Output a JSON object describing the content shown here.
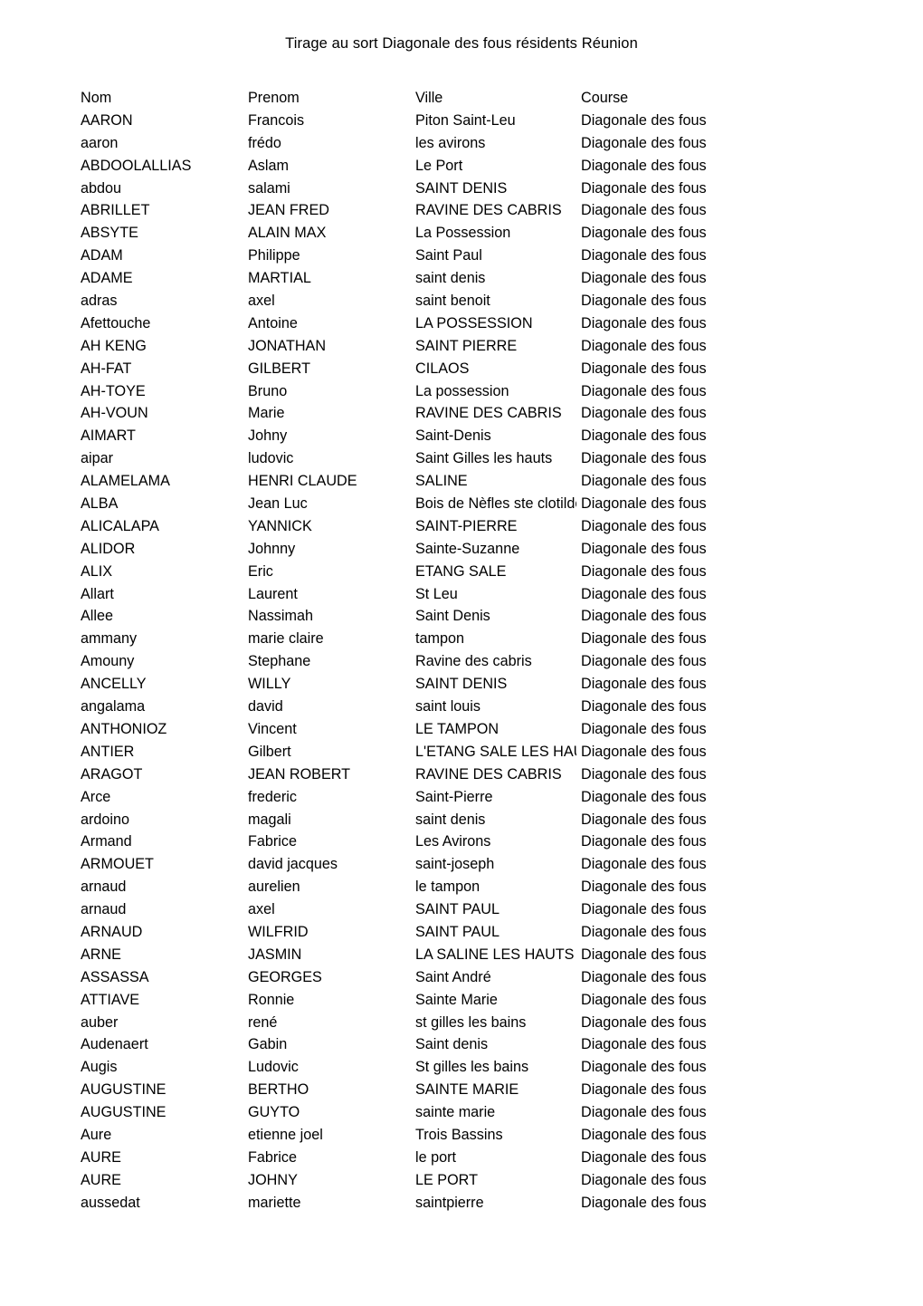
{
  "document": {
    "title": "Tirage au sort Diagonale des fous résidents Réunion"
  },
  "table": {
    "columns": [
      {
        "key": "nom",
        "label": "Nom"
      },
      {
        "key": "prenom",
        "label": "Prenom"
      },
      {
        "key": "ville",
        "label": "Ville"
      },
      {
        "key": "course",
        "label": "Course"
      }
    ],
    "rows": [
      {
        "nom": "AARON",
        "prenom": "Francois",
        "ville": "Piton Saint-Leu",
        "course": "Diagonale des fous"
      },
      {
        "nom": "aaron",
        "prenom": "frédo",
        "ville": "les avirons",
        "course": "Diagonale des fous"
      },
      {
        "nom": "ABDOOLALLIAS",
        "prenom": "Aslam",
        "ville": "Le Port",
        "course": "Diagonale des fous"
      },
      {
        "nom": "abdou",
        "prenom": "salami",
        "ville": "SAINT DENIS",
        "course": "Diagonale des fous"
      },
      {
        "nom": "ABRILLET",
        "prenom": "JEAN FRED",
        "ville": "RAVINE DES CABRIS",
        "course": "Diagonale des fous"
      },
      {
        "nom": "ABSYTE",
        "prenom": "ALAIN MAX",
        "ville": "La Possession",
        "course": "Diagonale des fous"
      },
      {
        "nom": "ADAM",
        "prenom": "Philippe",
        "ville": "Saint Paul",
        "course": "Diagonale des fous"
      },
      {
        "nom": "ADAME",
        "prenom": "MARTIAL",
        "ville": "saint denis",
        "course": "Diagonale des fous"
      },
      {
        "nom": "adras",
        "prenom": "axel",
        "ville": "saint benoit",
        "course": "Diagonale des fous"
      },
      {
        "nom": "Afettouche",
        "prenom": "Antoine",
        "ville": "LA POSSESSION",
        "course": "Diagonale des fous"
      },
      {
        "nom": "AH KENG",
        "prenom": "JONATHAN",
        "ville": "SAINT PIERRE",
        "course": "Diagonale des fous"
      },
      {
        "nom": "AH-FAT",
        "prenom": "GILBERT",
        "ville": "CILAOS",
        "course": "Diagonale des fous"
      },
      {
        "nom": "AH-TOYE",
        "prenom": "Bruno",
        "ville": "La possession",
        "course": "Diagonale des fous"
      },
      {
        "nom": "AH-VOUN",
        "prenom": "Marie",
        "ville": "RAVINE DES CABRIS",
        "course": "Diagonale des fous"
      },
      {
        "nom": "AIMART",
        "prenom": "Johny",
        "ville": "Saint-Denis",
        "course": "Diagonale des fous"
      },
      {
        "nom": "aipar",
        "prenom": "ludovic",
        "ville": "Saint Gilles les hauts",
        "course": "Diagonale des fous"
      },
      {
        "nom": "ALAMELAMA",
        "prenom": "HENRI CLAUDE",
        "ville": "SALINE",
        "course": "Diagonale des fous"
      },
      {
        "nom": "ALBA",
        "prenom": "Jean Luc",
        "ville": "Bois de Nèfles ste clotilde",
        "course": "Diagonale des fous"
      },
      {
        "nom": "ALICALAPA",
        "prenom": "YANNICK",
        "ville": "SAINT-PIERRE",
        "course": "Diagonale des fous"
      },
      {
        "nom": "ALIDOR",
        "prenom": "Johnny",
        "ville": "Sainte-Suzanne",
        "course": "Diagonale des fous"
      },
      {
        "nom": "ALIX",
        "prenom": "Eric",
        "ville": "ETANG SALE",
        "course": "Diagonale des fous"
      },
      {
        "nom": "Allart",
        "prenom": "Laurent",
        "ville": "St Leu",
        "course": "Diagonale des fous"
      },
      {
        "nom": "Allee",
        "prenom": "Nassimah",
        "ville": "Saint Denis",
        "course": "Diagonale des fous"
      },
      {
        "nom": "ammany",
        "prenom": "marie claire",
        "ville": "tampon",
        "course": "Diagonale des fous"
      },
      {
        "nom": "Amouny",
        "prenom": "Stephane",
        "ville": "Ravine des cabris",
        "course": "Diagonale des fous"
      },
      {
        "nom": "ANCELLY",
        "prenom": "WILLY",
        "ville": "SAINT DENIS",
        "course": "Diagonale des fous"
      },
      {
        "nom": "angalama",
        "prenom": "david",
        "ville": "saint louis",
        "course": "Diagonale des fous"
      },
      {
        "nom": "ANTHONIOZ",
        "prenom": "Vincent",
        "ville": "LE TAMPON",
        "course": "Diagonale des fous"
      },
      {
        "nom": "ANTIER",
        "prenom": "Gilbert",
        "ville": "L'ETANG SALE LES HAUTS",
        "course": "Diagonale des fous"
      },
      {
        "nom": "ARAGOT",
        "prenom": "JEAN ROBERT",
        "ville": "RAVINE DES CABRIS",
        "course": "Diagonale des fous"
      },
      {
        "nom": "Arce",
        "prenom": "frederic",
        "ville": "Saint-Pierre",
        "course": "Diagonale des fous"
      },
      {
        "nom": "ardoino",
        "prenom": "magali",
        "ville": "saint denis",
        "course": "Diagonale des fous"
      },
      {
        "nom": "Armand",
        "prenom": "Fabrice",
        "ville": "Les Avirons",
        "course": "Diagonale des fous"
      },
      {
        "nom": "ARMOUET",
        "prenom": "david jacques",
        "ville": "saint-joseph",
        "course": "Diagonale des fous"
      },
      {
        "nom": "arnaud",
        "prenom": "aurelien",
        "ville": "le tampon",
        "course": "Diagonale des fous"
      },
      {
        "nom": "arnaud",
        "prenom": "axel",
        "ville": "SAINT PAUL",
        "course": "Diagonale des fous"
      },
      {
        "nom": "ARNAUD",
        "prenom": "WILFRID",
        "ville": "SAINT PAUL",
        "course": "Diagonale des fous"
      },
      {
        "nom": "ARNE",
        "prenom": "JASMIN",
        "ville": "LA SALINE LES HAUTS",
        "course": "Diagonale des fous"
      },
      {
        "nom": "ASSASSA",
        "prenom": "GEORGES",
        "ville": "Saint André",
        "course": "Diagonale des fous"
      },
      {
        "nom": "ATTIAVE",
        "prenom": "Ronnie",
        "ville": "Sainte Marie",
        "course": "Diagonale des fous"
      },
      {
        "nom": "auber",
        "prenom": "rené",
        "ville": "st gilles les bains",
        "course": "Diagonale des fous"
      },
      {
        "nom": "Audenaert",
        "prenom": "Gabin",
        "ville": "Saint denis",
        "course": "Diagonale des fous"
      },
      {
        "nom": "Augis",
        "prenom": "Ludovic",
        "ville": "St gilles les bains",
        "course": "Diagonale des fous"
      },
      {
        "nom": "AUGUSTINE",
        "prenom": "BERTHO",
        "ville": "SAINTE MARIE",
        "course": "Diagonale des fous"
      },
      {
        "nom": "AUGUSTINE",
        "prenom": "GUYTO",
        "ville": "sainte marie",
        "course": "Diagonale des fous"
      },
      {
        "nom": "Aure",
        "prenom": "etienne joel",
        "ville": "Trois Bassins",
        "course": "Diagonale des fous"
      },
      {
        "nom": "AURE",
        "prenom": "Fabrice",
        "ville": "le port",
        "course": "Diagonale des fous"
      },
      {
        "nom": "AURE",
        "prenom": "JOHNY",
        "ville": "LE PORT",
        "course": "Diagonale des fous"
      },
      {
        "nom": "aussedat",
        "prenom": "mariette",
        "ville": "saintpierre",
        "course": "Diagonale des fous"
      }
    ]
  }
}
